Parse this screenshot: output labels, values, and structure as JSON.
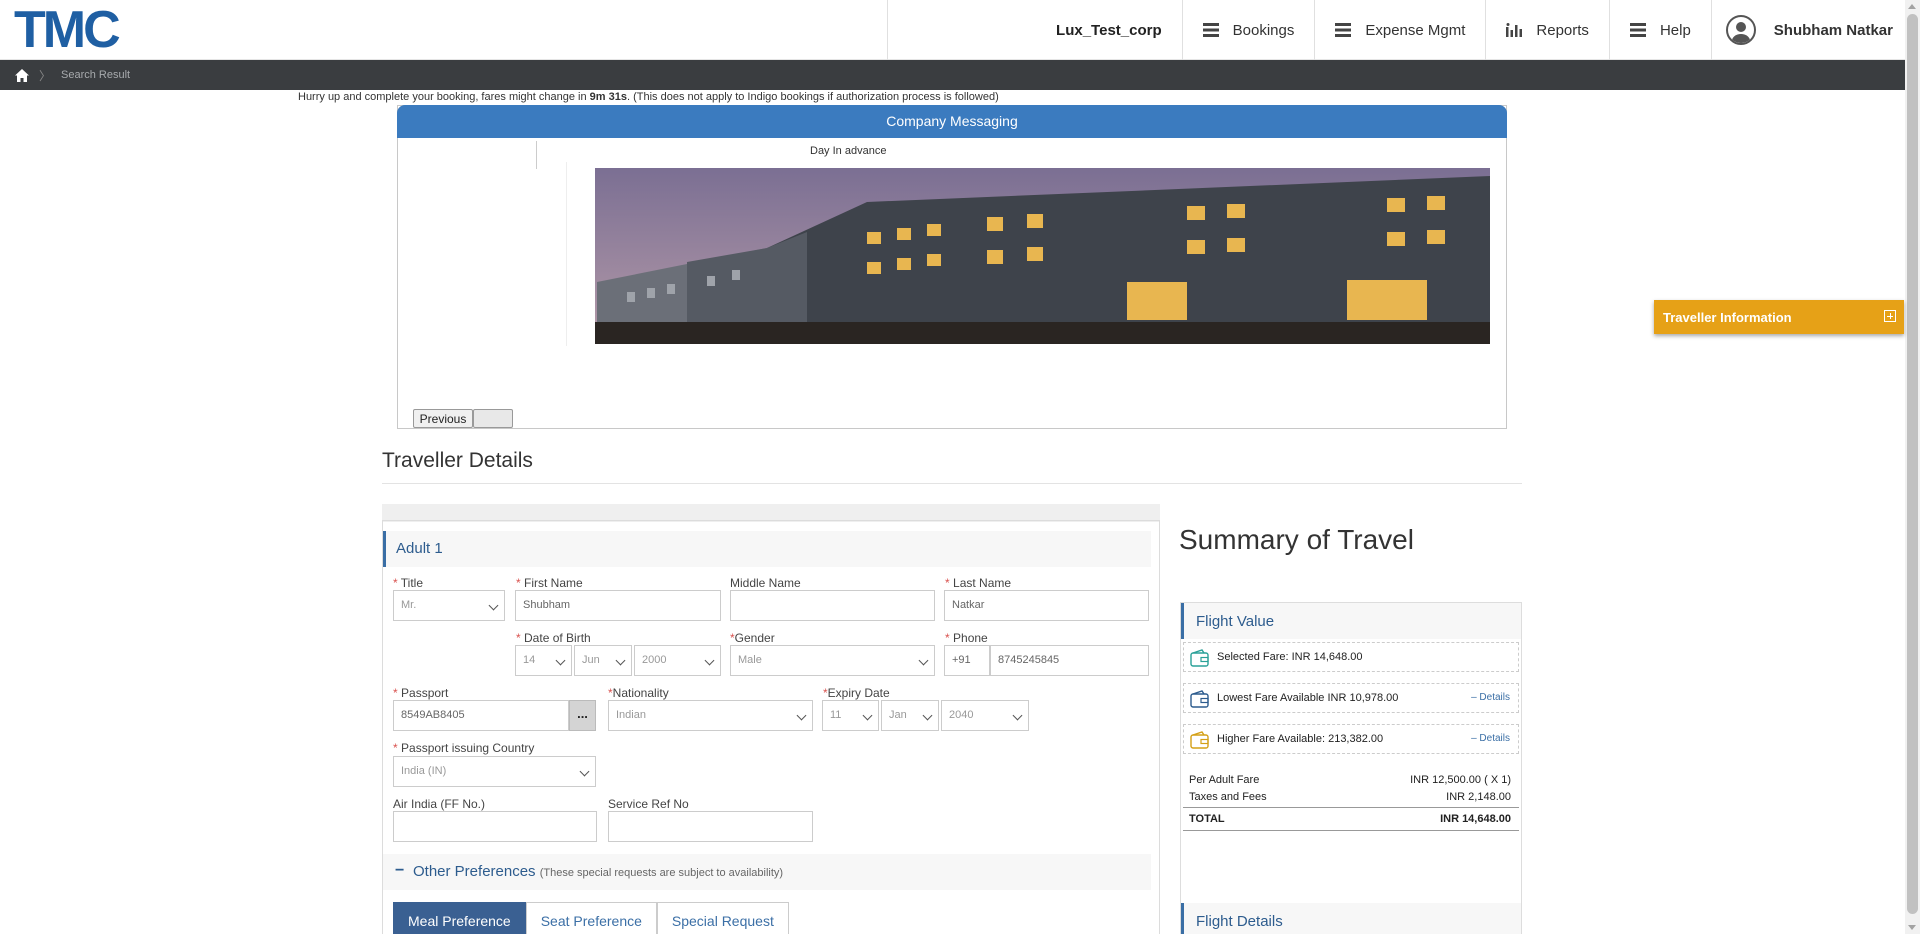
{
  "header": {
    "logo": "TMC",
    "corp_name": "Lux_Test_corp",
    "nav": [
      {
        "label": "Bookings",
        "icon": "menu-icon"
      },
      {
        "label": "Expense Mgmt",
        "icon": "menu-icon"
      },
      {
        "label": "Reports",
        "icon": "bar-chart-icon"
      },
      {
        "label": "Help",
        "icon": "menu-icon"
      }
    ],
    "user_name": "Shubham Natkar"
  },
  "breadcrumb": {
    "current": "Search Result"
  },
  "timer": {
    "prefix": "Hurry up and complete your booking, fares might change in ",
    "time": "9m 31s",
    "suffix": ". (This does not apply to Indigo bookings if authorization process is followed)"
  },
  "company_messaging": {
    "title": "Company Messaging",
    "caption": "Day In advance",
    "previous_label": "Previous",
    "next_label": ""
  },
  "traveller_details": {
    "title": "Traveller Details",
    "adult_label": "Adult 1",
    "fields": {
      "title_label": "Title",
      "title_value": "Mr.",
      "first_name_label": "First Name",
      "first_name_value": "Shubham",
      "middle_name_label": "Middle Name",
      "middle_name_value": "",
      "last_name_label": "Last Name",
      "last_name_value": "Natkar",
      "dob_label": "Date of Birth",
      "dob_day": "14",
      "dob_month": "Jun",
      "dob_year": "2000",
      "gender_label": "Gender",
      "gender_value": "Male",
      "phone_label": "Phone",
      "phone_code": "+91",
      "phone_number": "8745245845",
      "passport_label": "Passport",
      "passport_value": "8549AB8405",
      "passport_btn": "...",
      "nationality_label": "Nationality",
      "nationality_value": "Indian",
      "expiry_label": "Expiry Date",
      "expiry_day": "11",
      "expiry_month": "Jan",
      "expiry_year": "2040",
      "issuing_country_label": "Passport issuing Country",
      "issuing_country_value": "India (IN)",
      "ff_label": "Air India (FF No.)",
      "ff_value": "",
      "service_ref_label": "Service Ref No",
      "service_ref_value": ""
    },
    "other_preferences": {
      "title": "Other Preferences",
      "note": "(These special requests are subject to availability)",
      "tabs": [
        "Meal Preference",
        "Seat Preference",
        "Special Request"
      ],
      "active_tab": "Meal Preference"
    }
  },
  "summary": {
    "title": "Summary of Travel",
    "flight_value_label": "Flight Value",
    "selected_fare": "Selected Fare: INR 14,648.00",
    "lowest_fare": "Lowest Fare Available INR 10,978.00",
    "higher_fare": "Higher Fare Available: 213,382.00",
    "details_label": "– Details",
    "per_adult_label": "Per Adult Fare",
    "per_adult_value": "INR 12,500.00 ( X 1)",
    "taxes_label": "Taxes and Fees",
    "taxes_value": "INR 2,148.00",
    "total_label": "TOTAL",
    "total_value": "INR 14,648.00",
    "flight_details_label": "Flight Details"
  },
  "floating_panel": {
    "label": "Traveller Information"
  },
  "colors": {
    "brand_blue": "#1f5fa3",
    "header_blue": "#3b7bbf",
    "accent_orange": "#e6a117",
    "dark_bar": "#3a3d40"
  }
}
